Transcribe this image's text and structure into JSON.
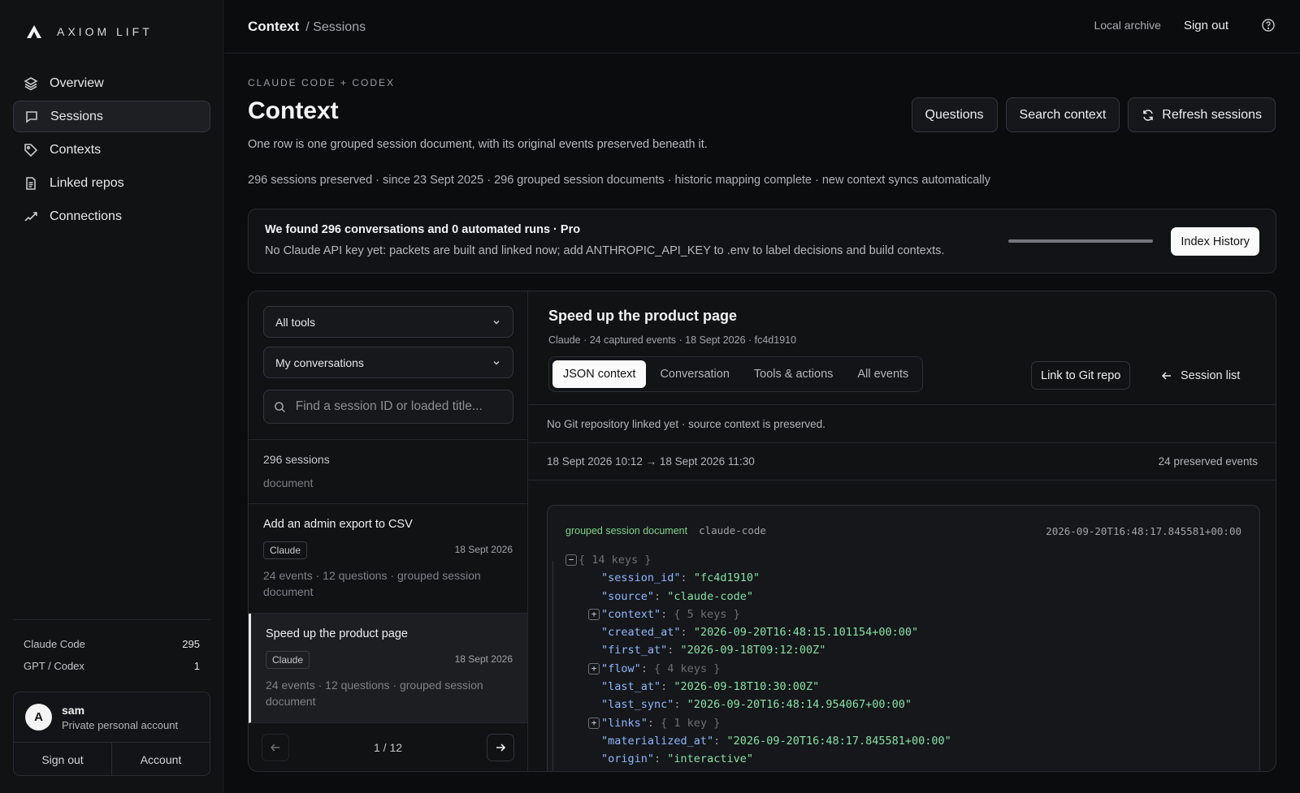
{
  "brand": {
    "name": "AXIOM LIFT"
  },
  "sidebar": {
    "items": [
      {
        "label": "Overview",
        "icon": "layers-icon"
      },
      {
        "label": "Sessions",
        "icon": "message-icon",
        "active": true
      },
      {
        "label": "Contexts",
        "icon": "tag-icon"
      },
      {
        "label": "Linked repos",
        "icon": "file-icon"
      },
      {
        "label": "Connections",
        "icon": "link-icon"
      }
    ],
    "usage": [
      {
        "label": "Claude Code",
        "value": "295"
      },
      {
        "label": "GPT / Codex",
        "value": "1"
      }
    ],
    "account": {
      "initial": "A",
      "name": "sam",
      "subtitle": "Private personal account",
      "sign_out": "Sign out",
      "account": "Account"
    }
  },
  "topbar": {
    "crumb_main": "Context",
    "crumb_sub": "/ Sessions",
    "local_archive": "Local archive",
    "sign_out": "Sign out"
  },
  "header": {
    "eyebrow": "CLAUDE CODE + CODEX",
    "title": "Context",
    "description": "One row is one grouped session document, with its original events preserved beneath it.",
    "stats": "296 sessions preserved · since 23 Sept 2025 · 296 grouped session documents · historic mapping complete · new context syncs automatically",
    "buttons": {
      "questions": "Questions",
      "search": "Search context",
      "refresh": "Refresh sessions"
    }
  },
  "banner": {
    "title": "We found 296 conversations and 0 automated runs · Pro",
    "text": "No Claude API key yet: packets are built and linked now; add ANTHROPIC_API_KEY to .env to label decisions and build contexts.",
    "progress": 1.0,
    "button": "Index History"
  },
  "sessions_panel": {
    "tool_filter": "All tools",
    "scope_filter": "My conversations",
    "search_placeholder": "Find a session ID or loaded title...",
    "count": "296 sessions",
    "count_sub": "document",
    "items": [
      {
        "title": "Add an admin export to CSV",
        "tag": "Claude",
        "date": "18 Sept 2026",
        "meta": "24 events · 12 questions · grouped session document"
      },
      {
        "title": "Speed up the product page",
        "tag": "Claude",
        "date": "18 Sept 2026",
        "meta": "24 events · 12 questions · grouped session document",
        "active": true
      }
    ],
    "pager": "1 / 12"
  },
  "detail": {
    "title": "Speed up the product page",
    "meta": "Claude · 24 captured events · 18 Sept 2026 · fc4d1910",
    "tabs": [
      "JSON context",
      "Conversation",
      "Tools & actions",
      "All events"
    ],
    "link_button": "Link to Git repo",
    "back_button": "Session list",
    "git_note": "No Git repository linked yet · source context is preserved.",
    "range": "18 Sept 2026 10:12 → 18 Sept 2026 11:30",
    "events": "24 preserved events",
    "json": {
      "kind": "grouped session document",
      "source": "claude-code",
      "timestamp": "2026-09-20T16:48:17.845581+00:00",
      "root_summary": "{ 14 keys }",
      "lines": [
        {
          "key": "\"session_id\"",
          "value": "\"fc4d1910\""
        },
        {
          "key": "\"source\"",
          "value": "\"claude-code\""
        },
        {
          "key": "\"context\"",
          "collapsed": "{ 5 keys }"
        },
        {
          "key": "\"created_at\"",
          "value": "\"2026-09-20T16:48:15.101154+00:00\""
        },
        {
          "key": "\"first_at\"",
          "value": "\"2026-09-18T09:12:00Z\""
        },
        {
          "key": "\"flow\"",
          "collapsed": "{ 4 keys }"
        },
        {
          "key": "\"last_at\"",
          "value": "\"2026-09-18T10:30:00Z\""
        },
        {
          "key": "\"last_sync\"",
          "value": "\"2026-09-20T16:48:14.954067+00:00\""
        },
        {
          "key": "\"links\"",
          "collapsed": "{ 1 key }"
        },
        {
          "key": "\"materialized_at\"",
          "value": "\"2026-09-20T16:48:17.845581+00:00\""
        },
        {
          "key": "\"origin\"",
          "value": "\"interactive\""
        }
      ]
    }
  }
}
